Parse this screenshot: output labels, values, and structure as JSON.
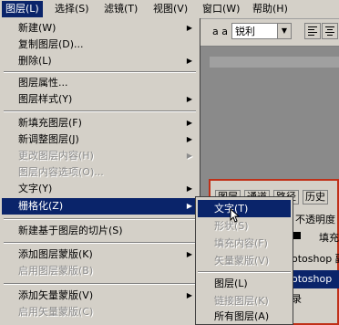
{
  "menubar": {
    "items": [
      {
        "label": "图层(L)"
      },
      {
        "label": "选择(S)"
      },
      {
        "label": "滤镜(T)"
      },
      {
        "label": "视图(V)"
      },
      {
        "label": "窗口(W)"
      },
      {
        "label": "帮助(H)"
      }
    ]
  },
  "toolbar": {
    "aa_label": "a a",
    "antialias_value": "锐利"
  },
  "menu": {
    "items": [
      {
        "label": "新建(W)",
        "submenu": true,
        "enabled": true
      },
      {
        "label": "复制图层(D)...",
        "submenu": false,
        "enabled": true
      },
      {
        "label": "删除(L)",
        "submenu": true,
        "enabled": true
      },
      {
        "label": "图层属性...",
        "submenu": false,
        "enabled": true
      },
      {
        "label": "图层样式(Y)",
        "submenu": true,
        "enabled": true
      },
      {
        "label": "新填充图层(F)",
        "submenu": true,
        "enabled": true
      },
      {
        "label": "新调整图层(J)",
        "submenu": true,
        "enabled": true
      },
      {
        "label": "更改图层内容(H)",
        "submenu": true,
        "enabled": false
      },
      {
        "label": "图层内容选项(O)...",
        "submenu": false,
        "enabled": false
      },
      {
        "label": "文字(Y)",
        "submenu": true,
        "enabled": true
      },
      {
        "label": "栅格化(Z)",
        "submenu": true,
        "enabled": true,
        "highlighted": true
      },
      {
        "label": "新建基于图层的切片(S)",
        "submenu": false,
        "enabled": true
      },
      {
        "label": "添加图层蒙版(K)",
        "submenu": true,
        "enabled": true
      },
      {
        "label": "启用图层蒙版(B)",
        "submenu": false,
        "enabled": false
      },
      {
        "label": "添加矢量蒙版(V)",
        "submenu": true,
        "enabled": true
      },
      {
        "label": "启用矢量蒙版(C)",
        "submenu": false,
        "enabled": false
      }
    ]
  },
  "submenu": {
    "items": [
      {
        "label": "文字(T)",
        "enabled": true,
        "highlighted": true
      },
      {
        "label": "形状(S)",
        "enabled": false
      },
      {
        "label": "填充内容(F)",
        "enabled": false
      },
      {
        "label": "矢量蒙版(V)",
        "enabled": false
      },
      {
        "label": "图层(L)",
        "enabled": true
      },
      {
        "label": "链接图层(K)",
        "enabled": false
      },
      {
        "label": "所有图层(A)",
        "enabled": true
      }
    ]
  },
  "layers_panel": {
    "tabs": [
      "图层",
      "通道",
      "路径",
      "历史"
    ],
    "opacity_label": "不透明度",
    "fill_label": "填充",
    "rows": [
      "otoshop 副",
      "otoshop",
      "录"
    ]
  }
}
